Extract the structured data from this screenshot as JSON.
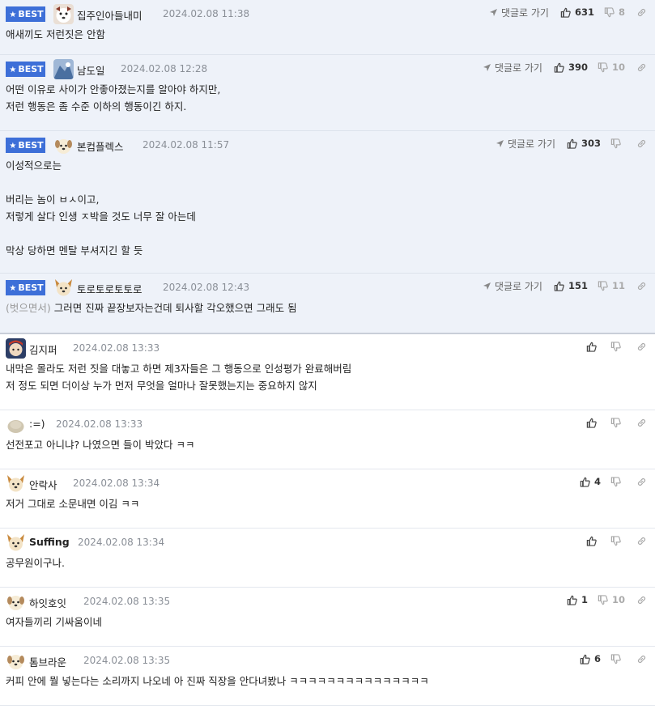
{
  "labels": {
    "best": "BEST",
    "reply": "댓글로 가기"
  },
  "colors": {
    "best_badge": "#3d6fd8",
    "best_bg": "#eef2f9"
  },
  "comments": [
    {
      "best": true,
      "nick": "집주인아들내미",
      "date": "2024.02.08 11:38",
      "up": "631",
      "down": "8",
      "text": "애새끼도 저런짓은 안함"
    },
    {
      "best": true,
      "nick": "남도일",
      "date": "2024.02.08 12:28",
      "up": "390",
      "down": "10",
      "text": "어떤 이유로 사이가 안좋아졌는지를 알아야 하지만,\n저런 행동은 좀 수준 이하의 행동이긴 하지."
    },
    {
      "best": true,
      "nick": "본컴플렉스",
      "date": "2024.02.08 11:57",
      "up": "303",
      "down": "",
      "text": "이성적으로는\n\n버리는 놈이 ㅂㅅ이고,\n저렇게 살다 인생 ㅈ박을 것도 너무 잘 아는데\n\n막상 당하면 멘탈 부셔지긴 할 듯"
    },
    {
      "best": true,
      "nick": "토로토로토토로",
      "date": "2024.02.08 12:43",
      "up": "151",
      "down": "11",
      "mention": "(벗으면서)",
      "text": " 그러면 진짜 끝장보자는건데 퇴사할 각오했으면 그래도 됨"
    },
    {
      "best": false,
      "nick": "김지퍼",
      "date": "2024.02.08 13:33",
      "up": "",
      "down": "",
      "text": "내막은 몰라도 저런 짓을 대놓고 하면 제3자들은 그 행동으로 인성평가 완료해버림\n저 정도 되면 더이상 누가 먼저 무엇을 얼마나 잘못했는지는 중요하지 않지"
    },
    {
      "best": false,
      "nick": ":=)",
      "date": "2024.02.08 13:33",
      "up": "",
      "down": "",
      "text": "선전포고 아니냐? 나였으면 들이 박았다 ㅋㅋ"
    },
    {
      "best": false,
      "nick": "안락사",
      "date": "2024.02.08 13:34",
      "up": "4",
      "down": "",
      "text": "저거 그대로 소문내면 이김 ㅋㅋ"
    },
    {
      "best": false,
      "nick": "Suffing",
      "date": "2024.02.08 13:34",
      "up": "",
      "down": "",
      "text": "공무원이구나."
    },
    {
      "best": false,
      "nick": "하잇호잇",
      "date": "2024.02.08 13:35",
      "up": "1",
      "down": "10",
      "text": "여자들끼리 기싸움이네"
    },
    {
      "best": false,
      "nick": "톰브라운",
      "date": "2024.02.08 13:35",
      "up": "6",
      "down": "",
      "text": "커피 안에 뭘 넣는다는 소리까지 나오네 아 진짜 직장을 안다녀봤나 ㅋㅋㅋㅋㅋㅋㅋㅋㅋㅋㅋㅋㅋㅋㅋ"
    }
  ]
}
